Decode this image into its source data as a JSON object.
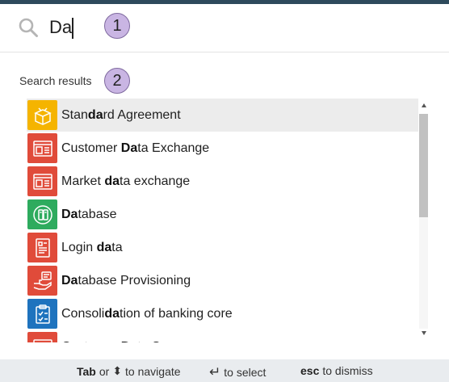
{
  "search": {
    "query": "Da"
  },
  "callouts": [
    "1",
    "2"
  ],
  "section_label": "Search results",
  "results": [
    {
      "icon": "box-open-icon",
      "color": "#f5b400",
      "parts": [
        {
          "t": "Stan",
          "b": false
        },
        {
          "t": "da",
          "b": true
        },
        {
          "t": "rd Agreement",
          "b": false
        }
      ],
      "selected": true
    },
    {
      "icon": "data-exchange-icon",
      "color": "#e04b3a",
      "parts": [
        {
          "t": "Customer ",
          "b": false
        },
        {
          "t": "Da",
          "b": true
        },
        {
          "t": "ta Exchange",
          "b": false
        }
      ],
      "selected": false
    },
    {
      "icon": "data-exchange-icon",
      "color": "#e04b3a",
      "parts": [
        {
          "t": "Market ",
          "b": false
        },
        {
          "t": "da",
          "b": true
        },
        {
          "t": "ta exchange",
          "b": false
        }
      ],
      "selected": false
    },
    {
      "icon": "database-icon",
      "color": "#2eab5e",
      "parts": [
        {
          "t": "Da",
          "b": true
        },
        {
          "t": "tabase",
          "b": false
        }
      ],
      "selected": false
    },
    {
      "icon": "login-document-icon",
      "color": "#e04b3a",
      "parts": [
        {
          "t": "Login ",
          "b": false
        },
        {
          "t": "da",
          "b": true
        },
        {
          "t": "ta",
          "b": false
        }
      ],
      "selected": false
    },
    {
      "icon": "hand-provision-icon",
      "color": "#e04b3a",
      "parts": [
        {
          "t": "Da",
          "b": true
        },
        {
          "t": "tabase Provisioning",
          "b": false
        }
      ],
      "selected": false
    },
    {
      "icon": "clipboard-check-icon",
      "color": "#1e73be",
      "parts": [
        {
          "t": "Consoli",
          "b": false
        },
        {
          "t": "da",
          "b": true
        },
        {
          "t": "tion of banking core",
          "b": false
        }
      ],
      "selected": false
    },
    {
      "icon": "data-exchange-icon",
      "color": "#e04b3a",
      "parts": [
        {
          "t": "Customer ",
          "b": false
        },
        {
          "t": "Da",
          "b": true
        },
        {
          "t": "ta S",
          "b": false
        }
      ],
      "selected": false
    }
  ],
  "footer": {
    "nav_key": "Tab",
    "nav_or": "or",
    "nav_arrows": "⬍",
    "nav_text": "to navigate",
    "select_symbol": "↵",
    "select_text": "to select",
    "dismiss_key": "esc",
    "dismiss_text": "to dismiss"
  },
  "colors": {
    "accent_bar": "#2e4a5c",
    "callout_fill": "#c9b5e3",
    "selected_row": "#ececec",
    "footer_bg": "#e9ecef"
  }
}
